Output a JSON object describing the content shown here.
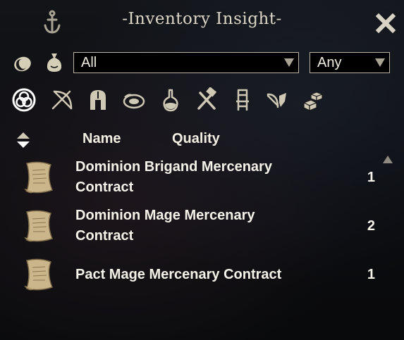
{
  "window": {
    "title": "-Inventory Insight-"
  },
  "filters": {
    "type_selected": "All",
    "quality_selected": "Any"
  },
  "category_icons": [
    "all-items-icon",
    "weapons-icon",
    "armor-icon",
    "consumables-icon",
    "potions-icon",
    "crafting-icon",
    "furniture-icon",
    "miscellaneous-icon",
    "junk-icon"
  ],
  "columns": {
    "name": "Name",
    "quality": "Quality"
  },
  "items": [
    {
      "name": "Dominion Brigand Mercenary Contract",
      "quantity": "1"
    },
    {
      "name": "Dominion Mage Mercenary Contract",
      "quantity": "2"
    },
    {
      "name": "Pact Mage Mercenary Contract",
      "quantity": "1"
    }
  ],
  "colors": {
    "selected_category": "#ffffff",
    "icon": "#cfc8b4",
    "dropdown_border": "#b8b2a0"
  }
}
